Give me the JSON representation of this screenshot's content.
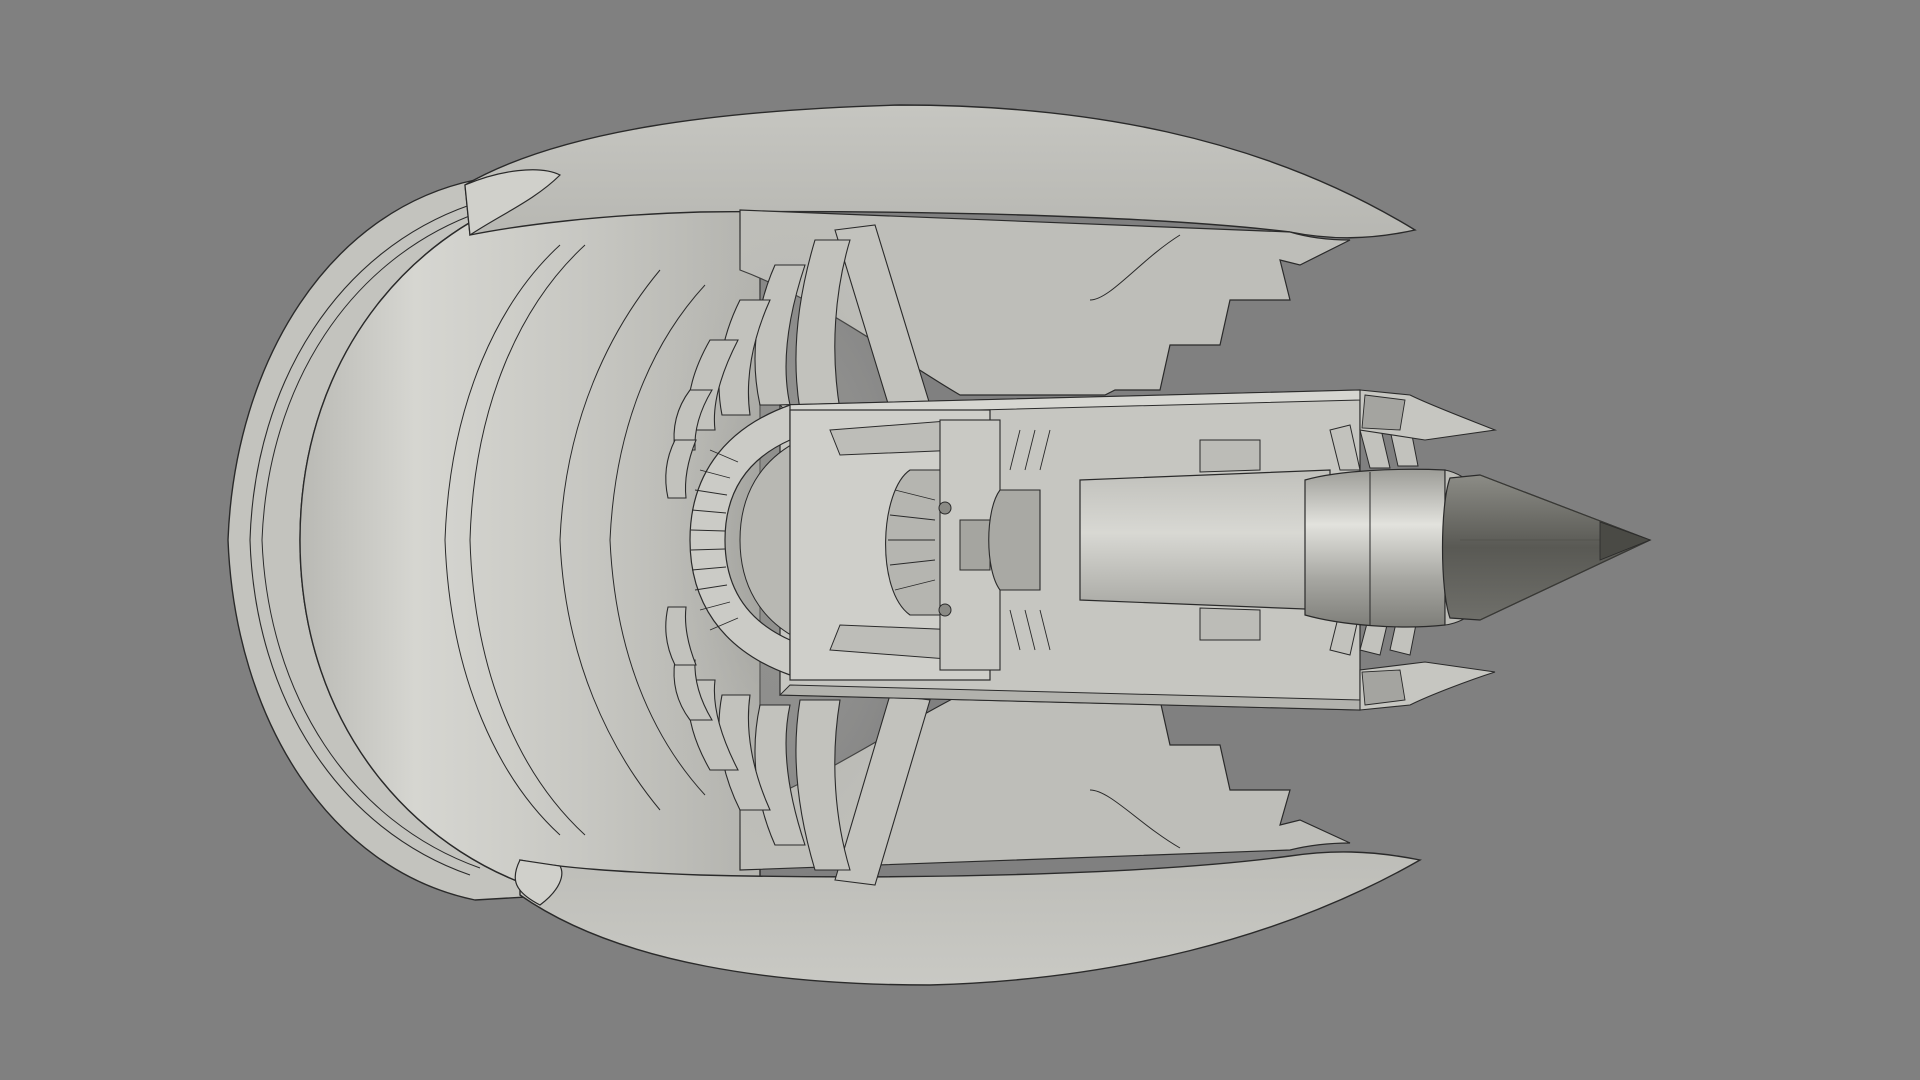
{
  "viewport": {
    "background_color": "#808080"
  },
  "model": {
    "subject": "turbofan-engine-cutaway",
    "colors": {
      "body": "#c4c4bf",
      "body_light": "#d3d3ce",
      "body_shadow": "#a9a9a4",
      "blade": "#bdbdb8",
      "edge": "#2a2a2a",
      "cone_dark": "#5a5a55",
      "cone_mid": "#8c8c86",
      "metal": "#9a9a95"
    }
  }
}
